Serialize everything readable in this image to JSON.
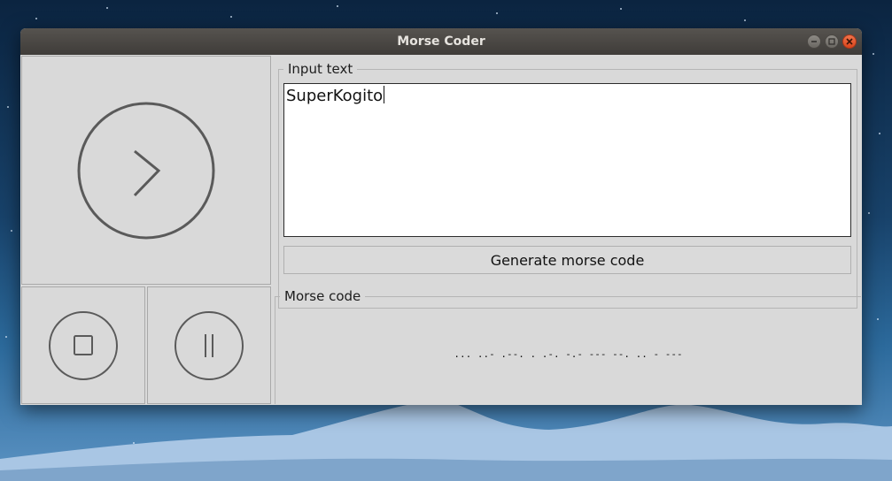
{
  "window": {
    "title": "Morse Coder"
  },
  "controls": {
    "play_icon": "chevron-right-icon",
    "stop_icon": "stop-icon",
    "pause_icon": "pause-icon"
  },
  "input_section": {
    "legend": "Input text",
    "value": "SuperKogito",
    "button_label": "Generate morse code"
  },
  "output_section": {
    "legend": "Morse code",
    "value": "...  ..-  .--.  .  .-.  -.-  ---  --.  ..  -  ---"
  },
  "colors": {
    "titlebar": "#46433f",
    "panel": "#d9d9d9",
    "close_button": "#e2552d",
    "icon_stroke": "#5a5a5a"
  }
}
